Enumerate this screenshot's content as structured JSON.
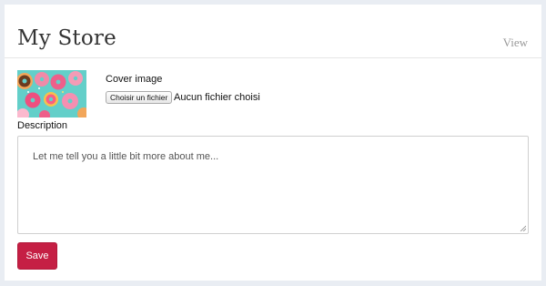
{
  "header": {
    "store_name": "My Store",
    "view_link": "View"
  },
  "cover": {
    "label": "Cover image",
    "image_icon": "donuts-photo",
    "file_button": "Choisir un fichier",
    "file_status": "Aucun fichier choisi"
  },
  "description": {
    "label": "Description",
    "placeholder": "Let me tell you a little bit more about me..."
  },
  "actions": {
    "save_label": "Save"
  },
  "colors": {
    "accent": "#c51f44",
    "page_bg": "#e9edf3",
    "thumb_bg": "#63cfc9"
  }
}
